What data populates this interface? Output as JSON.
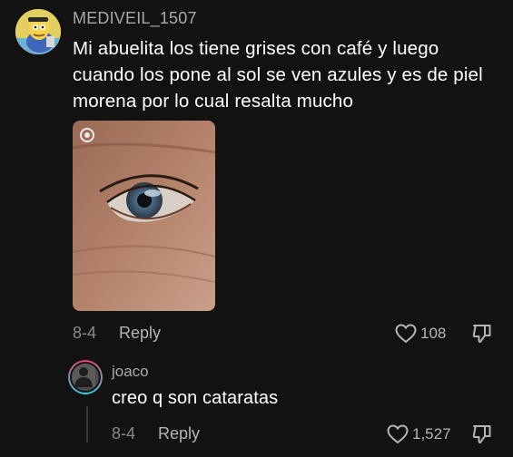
{
  "comment": {
    "username": "MEDIVEIL_1507",
    "text": "Mi abuelita los tiene grises con café y luego cuando los pone al sol se ven azules y es de piel morena por lo cual resalta mucho",
    "date": "8-4",
    "reply_label": "Reply",
    "like_count": "108",
    "avatar_icon": "cartoon-character-avatar",
    "photo_icon": "eye-closeup-photo"
  },
  "reply": {
    "username": "joaco",
    "text": "creo q son cataratas",
    "date": "8-4",
    "reply_label": "Reply",
    "like_count": "1,527",
    "avatar_icon": "person-avatar"
  },
  "colors": {
    "background": "#121212",
    "primary_text": "#ffffff",
    "secondary_text": "#a9a9a9",
    "story_ring_start": "#f23c6e",
    "story_ring_end": "#25d7e8"
  }
}
